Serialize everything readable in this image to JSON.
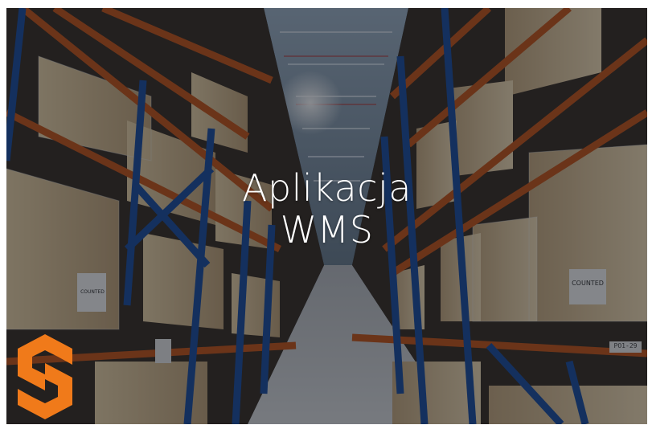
{
  "hero": {
    "title_line1": "Aplikacja",
    "title_line2": "WMS"
  },
  "labels": {
    "left_box": "COUNTED",
    "right_box": "COUNTED",
    "aisle_sign": "PO1-29"
  },
  "logo": {
    "icon": "s-hexagon-logo-icon",
    "color": "#f07a1a"
  },
  "colors": {
    "rack_orange": "#c4561c",
    "rack_blue": "#1e4fa0",
    "overlay": "#0a0e16"
  }
}
